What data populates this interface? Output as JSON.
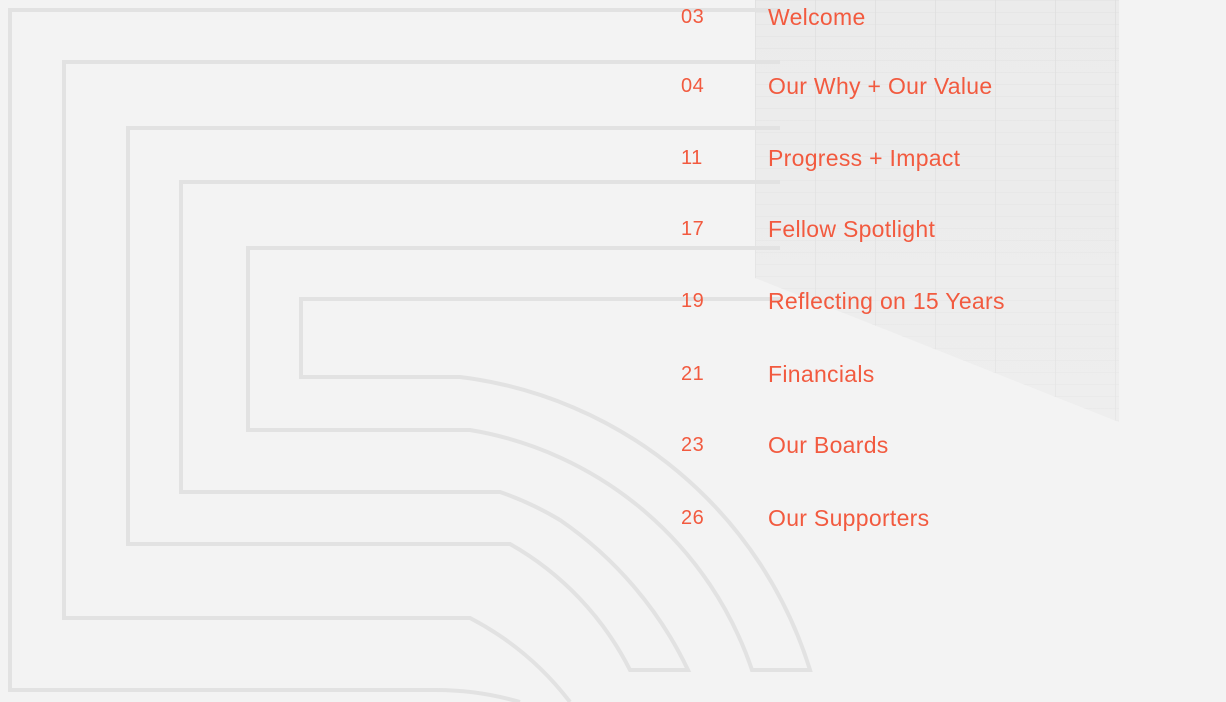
{
  "colors": {
    "background": "#f3f3f3",
    "accent": "#f25a3f",
    "line": "#e2e2e2"
  },
  "toc": {
    "items": [
      {
        "page": "03",
        "title": "Welcome"
      },
      {
        "page": "04",
        "title": "Our Why + Our Value"
      },
      {
        "page": "11",
        "title": "Progress + Impact"
      },
      {
        "page": "17",
        "title": "Fellow Spotlight"
      },
      {
        "page": "19",
        "title": "Reflecting on 15 Years"
      },
      {
        "page": "21",
        "title": "Financials"
      },
      {
        "page": "23",
        "title": "Our Boards"
      },
      {
        "page": "26",
        "title": "Our Supporters"
      }
    ]
  }
}
